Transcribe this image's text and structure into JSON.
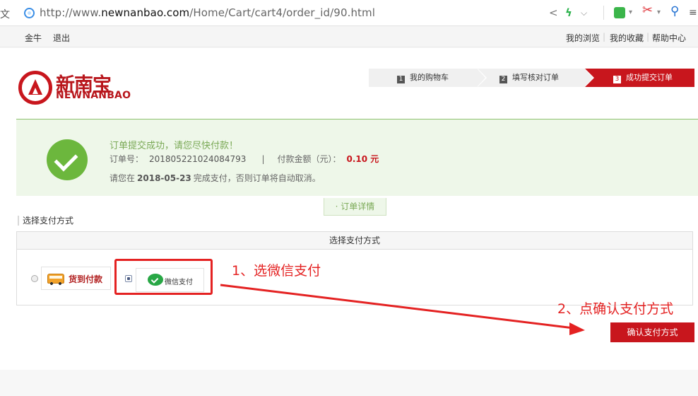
{
  "browser": {
    "url_prefix": "http://www.",
    "url_domain": "newnanbao.com",
    "url_path": "/Home/Cart/cart4/order_id/90.html"
  },
  "user_bar": {
    "left_links": [
      "金牛",
      "退出"
    ],
    "right_links": [
      "我的浏览",
      "我的收藏",
      "帮助中心"
    ]
  },
  "logo": {
    "cn": "新南宝",
    "en": "NEWNANBAO"
  },
  "steps": [
    {
      "num": "1",
      "label": "我的购物车"
    },
    {
      "num": "2",
      "label": "填写核对订单"
    },
    {
      "num": "3",
      "label": "成功提交订单"
    }
  ],
  "success": {
    "title": "订单提交成功，请您尽快付款！",
    "order_no_label": "订单号：",
    "order_no": "201805221024084793",
    "separator": "|",
    "amount_label": "付款金额（元）：",
    "amount": "0.10 元",
    "deadline_prefix": "请您在",
    "deadline_date": "2018-05-23",
    "deadline_suffix": "完成支付，否则订单将自动取消。"
  },
  "detail_tab": "· 订单详情",
  "section_label": "选择支付方式",
  "pay_box": {
    "header": "选择支付方式",
    "options": [
      {
        "label": "货到付款",
        "icon": "bus-icon",
        "selected": false
      },
      {
        "label": "微信支付",
        "icon": "wechat-icon",
        "selected": true
      }
    ]
  },
  "annotations": {
    "step1": "1、选微信支付",
    "step2": "2、点确认支付方式"
  },
  "confirm_button": "确认支付方式",
  "colors": {
    "brand_red": "#c8161d",
    "success_green": "#6cb73d",
    "annotation_red": "#e42222"
  }
}
